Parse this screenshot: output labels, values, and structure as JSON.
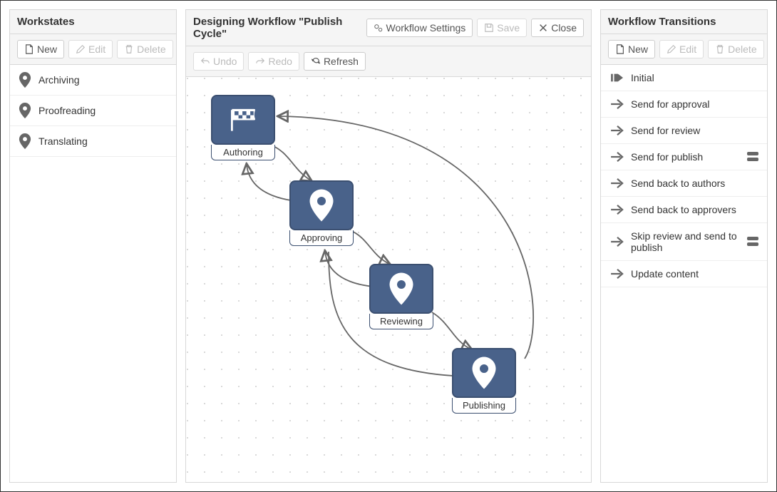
{
  "left": {
    "title": "Workstates",
    "new": "New",
    "edit": "Edit",
    "delete": "Delete",
    "items": [
      {
        "label": "Archiving"
      },
      {
        "label": "Proofreading"
      },
      {
        "label": "Translating"
      }
    ]
  },
  "center": {
    "title": "Designing Workflow \"Publish Cycle\"",
    "settings": "Workflow Settings",
    "save": "Save",
    "close": "Close",
    "undo": "Undo",
    "redo": "Redo",
    "refresh": "Refresh",
    "nodes": {
      "authoring": "Authoring",
      "approving": "Approving",
      "reviewing": "Reviewing",
      "publishing": "Publishing"
    }
  },
  "right": {
    "title": "Workflow Transitions",
    "new": "New",
    "edit": "Edit",
    "delete": "Delete",
    "items": [
      {
        "label": "Initial",
        "icon": "initial",
        "extra": false
      },
      {
        "label": "Send for approval",
        "icon": "arrow",
        "extra": false
      },
      {
        "label": "Send for review",
        "icon": "arrow",
        "extra": false
      },
      {
        "label": "Send for publish",
        "icon": "arrow",
        "extra": true
      },
      {
        "label": "Send back to authors",
        "icon": "arrow",
        "extra": false
      },
      {
        "label": "Send back to approvers",
        "icon": "arrow",
        "extra": false
      },
      {
        "label": "Skip review and send to publish",
        "icon": "arrow",
        "extra": true
      },
      {
        "label": "Update content",
        "icon": "arrow",
        "extra": false
      }
    ]
  }
}
